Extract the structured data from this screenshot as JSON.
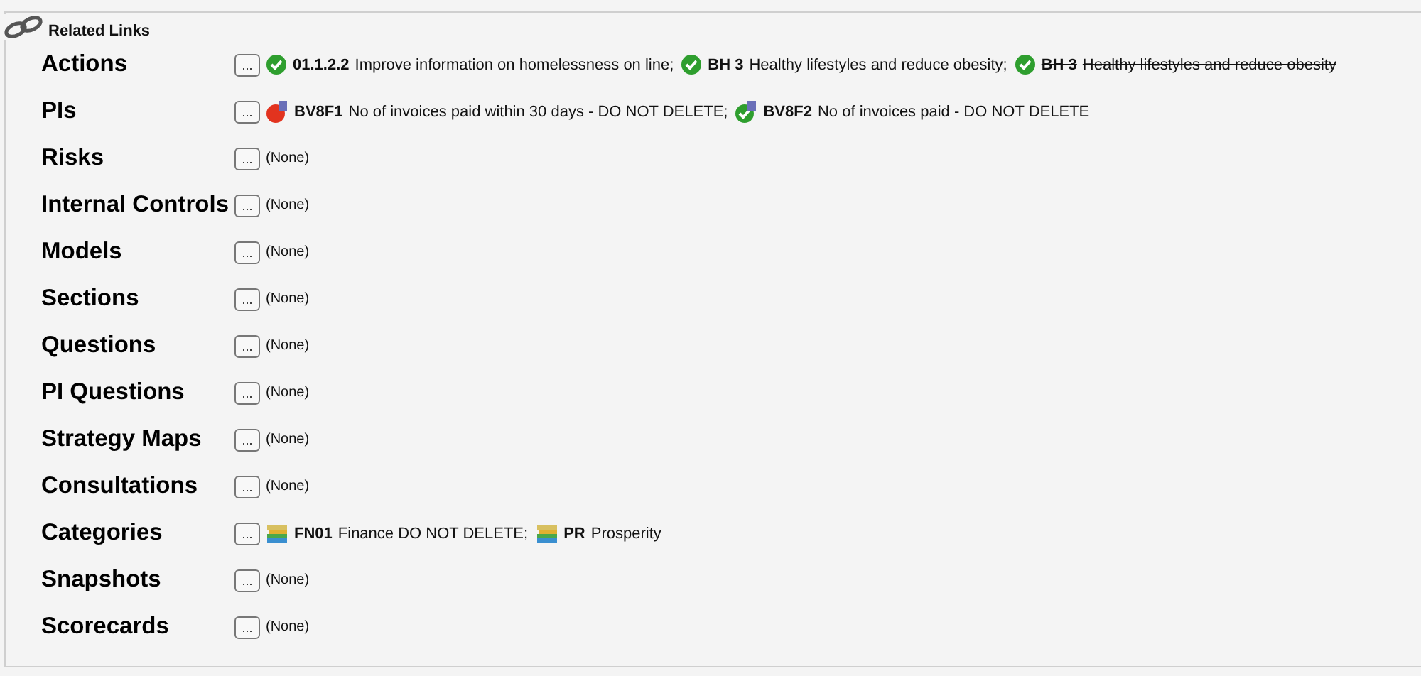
{
  "panel": {
    "title": "Related Links"
  },
  "rows": [
    {
      "label": "Actions",
      "button": "...",
      "links": [
        {
          "kind": "check",
          "code": "01.1.2.2",
          "text": "Improve information on homelessness on line;",
          "struck": false
        },
        {
          "kind": "check",
          "code": "BH 3",
          "text": "Healthy lifestyles and reduce obesity;",
          "struck": false
        },
        {
          "kind": "check",
          "code": "BH 3",
          "text": "Healthy lifestyles and reduce obesity",
          "struck": true
        }
      ]
    },
    {
      "label": "PIs",
      "button": "...",
      "links": [
        {
          "kind": "alert",
          "code": "BV8F1",
          "text": "No of invoices paid within 30 days - DO NOT DELETE;",
          "struck": false
        },
        {
          "kind": "check-flag",
          "code": "BV8F2",
          "text": "No of invoices paid - DO NOT DELETE",
          "struck": false
        }
      ]
    },
    {
      "label": "Risks",
      "button": "...",
      "empty": "(None)"
    },
    {
      "label": "Internal Controls",
      "button": "...",
      "empty": "(None)"
    },
    {
      "label": "Models",
      "button": "...",
      "empty": "(None)"
    },
    {
      "label": "Sections",
      "button": "...",
      "empty": "(None)"
    },
    {
      "label": "Questions",
      "button": "...",
      "empty": "(None)"
    },
    {
      "label": "PI Questions",
      "button": "...",
      "empty": "(None)"
    },
    {
      "label": "Strategy Maps",
      "button": "...",
      "empty": "(None)"
    },
    {
      "label": "Consultations",
      "button": "...",
      "empty": "(None)"
    },
    {
      "label": "Categories",
      "button": "...",
      "links": [
        {
          "kind": "books",
          "code": "FN01",
          "text": "Finance DO NOT DELETE;",
          "struck": false
        },
        {
          "kind": "books",
          "code": "PR",
          "text": "Prosperity",
          "struck": false
        }
      ]
    },
    {
      "label": "Snapshots",
      "button": "...",
      "empty": "(None)"
    },
    {
      "label": "Scorecards",
      "button": "...",
      "empty": "(None)"
    }
  ]
}
